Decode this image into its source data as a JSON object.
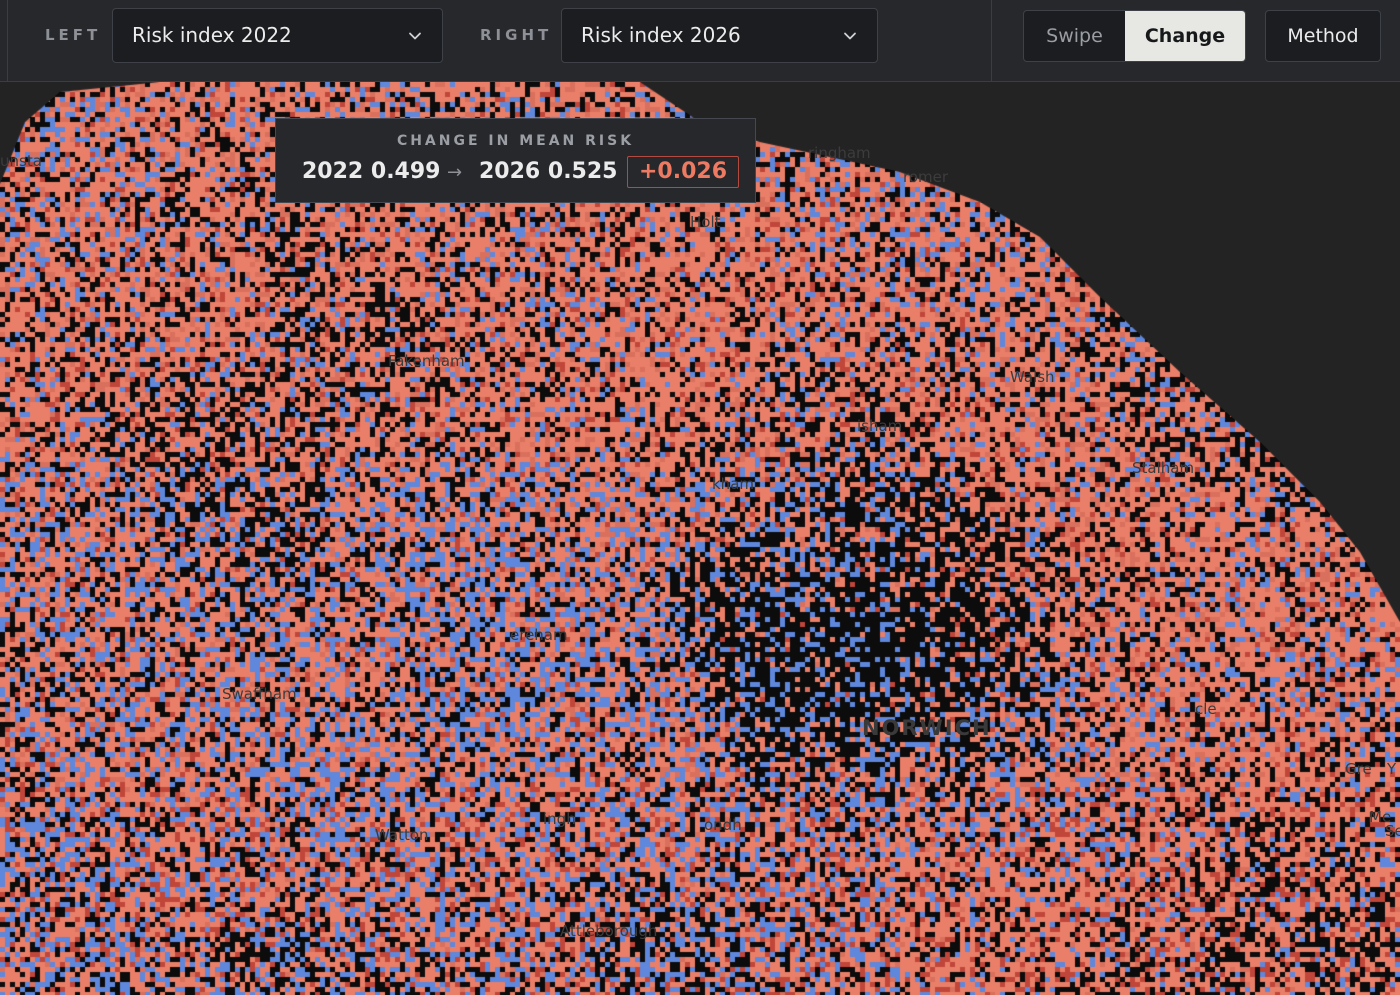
{
  "toolbar": {
    "left_label": "LEFT",
    "left_select_value": "Risk index 2022",
    "right_label": "RIGHT",
    "right_select_value": "Risk index 2026",
    "mode_options": [
      "Swipe",
      "Change"
    ],
    "mode_selected": "Change",
    "method_label": "Method",
    "chevron_icon": "chevron-down-icon"
  },
  "popup": {
    "title": "CHANGE IN MEAN RISK",
    "left_value": "2022 0.499",
    "arrow": "→",
    "right_value": "2026 0.525",
    "delta": "+0.026"
  },
  "map": {
    "place_labels": [
      "unsta",
      "ringham",
      "romer",
      "Holt",
      "Fakenham",
      "Walsh",
      "isham",
      "Stalham",
      "kham",
      "ereham",
      "Swaffham",
      "NORWICH",
      "cle",
      "Watton",
      "ingh",
      "ondh",
      "Attleborough",
      "Gre",
      "Y",
      "Me",
      "Se"
    ],
    "colors": {
      "increase": "#e97f68",
      "increase_strong": "#c0463a",
      "decrease": "#5f87db",
      "no_change": "#0c0c0c",
      "background": "#232323"
    }
  }
}
